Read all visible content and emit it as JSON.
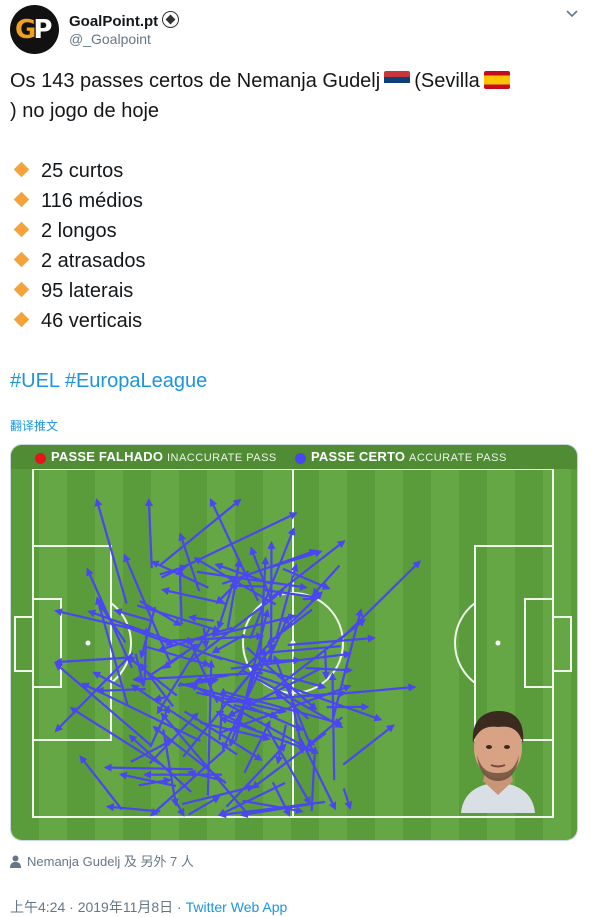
{
  "author": {
    "display_name": "GoalPoint.pt",
    "handle": "@_Goalpoint",
    "avatar_logo_g": "G",
    "avatar_logo_p": "P"
  },
  "tweet": {
    "line1_part1": "Os 143 passes certos de Nemanja Gudelj",
    "line1_part2": "(Sevilla",
    "line1_part3": ") no jogo de hoje",
    "bullets": [
      "25 curtos",
      "116 médios",
      "2 longos",
      "2 atrasados",
      "95 laterais",
      "46 verticais"
    ],
    "hashtags": "#UEL #EuropaLeague",
    "translate_link": "翻译推文"
  },
  "media": {
    "legend_inaccurate_main": "PASSE FALHADO",
    "legend_inaccurate_sub": "INACCURATE PASS",
    "legend_accurate_main": "PASSE CERTO",
    "legend_accurate_sub": "ACCURATE PASS",
    "colors": {
      "inaccurate": "#e8141c",
      "accurate": "#4a46f0",
      "pitch": "#5fa03f"
    }
  },
  "tagged": "Nemanja Gudelj 及 另外 7 人",
  "footer": {
    "time": "上午4:24 · 2019年11月8日 · ",
    "app": "Twitter Web App"
  },
  "icons": {
    "caret": "chevron-down-icon",
    "person": "person-icon",
    "emoji": "soccer-ball-icon"
  }
}
